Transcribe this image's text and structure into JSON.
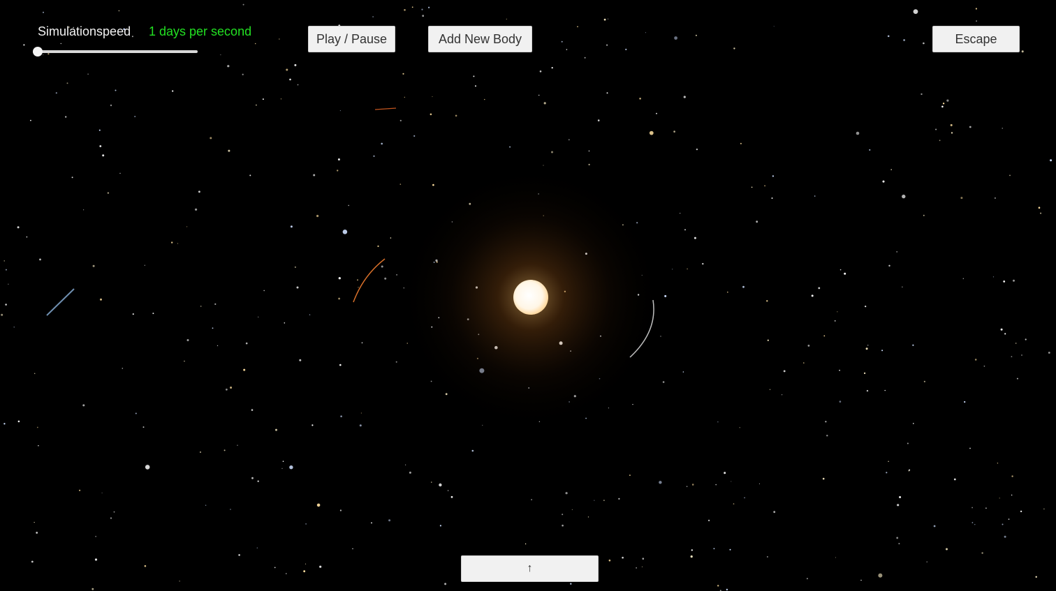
{
  "hud": {
    "speed_label": "Simulationspeed",
    "speed_value": "1 days per second",
    "speed_slider_level": 0.0
  },
  "buttons": {
    "play_pause": "Play / Pause",
    "add_new_body": "Add New Body",
    "escape": "Escape",
    "up": "↑"
  },
  "colors": {
    "background": "#000000",
    "speed_value": "#22e022",
    "sun_core": "#fff8ea",
    "sun_glow": "#ffb040",
    "orbit_orange": "#d8702a",
    "orbit_white": "#bfbfbf",
    "orbit_blue": "#6f8fb0",
    "button_bg": "#f1f1f1"
  },
  "icons": [
    "up-arrow-icon"
  ]
}
